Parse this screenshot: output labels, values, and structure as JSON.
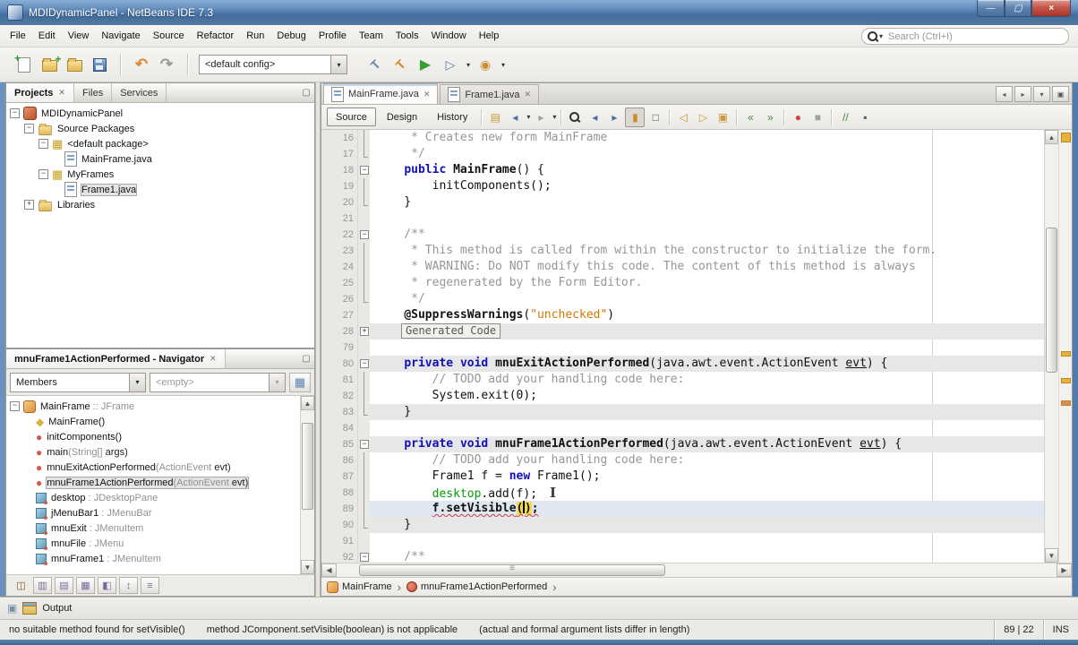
{
  "titlebar": {
    "title": "MDIDynamicPanel - NetBeans IDE 7.3"
  },
  "menubar": {
    "items": [
      "File",
      "Edit",
      "View",
      "Navigate",
      "Source",
      "Refactor",
      "Run",
      "Debug",
      "Profile",
      "Team",
      "Tools",
      "Window",
      "Help"
    ],
    "search_placeholder": "Search (Ctrl+I)"
  },
  "toolbar": {
    "config_value": "<default config>"
  },
  "icons": {
    "window-minimize": "—",
    "window-maximize": "▢",
    "window-close": "×",
    "undo": "↶",
    "redo": "↷",
    "build": "T",
    "clean-build": "T",
    "run": "▶",
    "debug": "▷",
    "profile": "◉",
    "combo-arrow": "▾",
    "dropdown-caret": "▾",
    "tab-scroll-left": "◂",
    "tab-scroll-right": "▸",
    "tab-list": "▾",
    "maximize-editor": "▣",
    "last-edit": "▤",
    "back": "◂",
    "forward": "▸",
    "find-prev": "◂",
    "find-next": "▸",
    "highlight": "▮",
    "rect-select": "□",
    "prev-bookmark": "◁",
    "next-bookmark": "▷",
    "toggle-bookmark": "▣",
    "shift-left": "«",
    "shift-right": "»",
    "record-macro": "●",
    "stop-macro": "■",
    "toggle-comment": "//",
    "inspect": "▪",
    "panel-minimize": "▢",
    "scroll-up": "▲",
    "scroll-down": "▼",
    "dock": "▣",
    "package": "▦",
    "show-inherited": "◫",
    "show-fields": "▥",
    "show-static": "▤",
    "show-public": "▦",
    "show-non-public": "◧",
    "sort-alpha": "↕",
    "sort-by-source": "≡",
    "nav-settings": "▦"
  },
  "projects_panel": {
    "tabs": [
      {
        "label": "Projects",
        "active": true,
        "closable": true
      },
      {
        "label": "Files"
      },
      {
        "label": "Services"
      }
    ],
    "tree": [
      {
        "label": "MDIDynamicPanel",
        "depth": 0,
        "icon": "project",
        "handle": "minus"
      },
      {
        "label": "Source Packages",
        "depth": 1,
        "icon": "folder",
        "handle": "minus"
      },
      {
        "label": "<default package>",
        "depth": 2,
        "icon": "package",
        "handle": "minus"
      },
      {
        "label": "MainFrame.java",
        "depth": 3,
        "icon": "form-file",
        "handle": "none"
      },
      {
        "label": "MyFrames",
        "depth": 2,
        "icon": "package",
        "handle": "minus"
      },
      {
        "label": "Frame1.java",
        "depth": 3,
        "icon": "file",
        "handle": "none",
        "selected": true
      },
      {
        "label": "Libraries",
        "depth": 1,
        "icon": "folder",
        "handle": "plus"
      }
    ]
  },
  "navigator": {
    "title": "mnuFrame1ActionPerformed - Navigator",
    "filter_members": "Members",
    "filter_scope": "<empty>",
    "filter_buttons": [
      "show-inherited",
      "show-fields",
      "show-static",
      "show-public",
      "show-non-public",
      "sort-alpha",
      "sort-by-source"
    ],
    "members": [
      {
        "name": "MainFrame",
        "sig": " :: JFrame",
        "icon": "class",
        "depth": 0,
        "handle": "minus"
      },
      {
        "name": "MainFrame()",
        "icon": "constructor",
        "depth": 1
      },
      {
        "name": "initComponents()",
        "icon": "method-private",
        "depth": 1
      },
      {
        "name": "main",
        "sig": "(String[] ",
        "sig2": "args)",
        "icon": "method-static",
        "depth": 1
      },
      {
        "name": "mnuExitActionPerformed",
        "sig": "(ActionEvent ",
        "sig2": "evt)",
        "icon": "method-private",
        "depth": 1
      },
      {
        "name": "mnuFrame1ActionPerformed",
        "sig": "(ActionEvent ",
        "sig2": "evt)",
        "icon": "method-private",
        "depth": 1,
        "selected": true
      },
      {
        "name": "desktop",
        "sig": " : JDesktopPane",
        "icon": "field",
        "depth": 1
      },
      {
        "name": "jMenuBar1",
        "sig": " : JMenuBar",
        "icon": "field",
        "depth": 1
      },
      {
        "name": "mnuExit",
        "sig": " : JMenuItem",
        "icon": "field",
        "depth": 1
      },
      {
        "name": "mnuFile",
        "sig": " : JMenu",
        "icon": "field",
        "depth": 1
      },
      {
        "name": "mnuFrame1",
        "sig": " : JMenuItem",
        "icon": "field",
        "depth": 1
      }
    ]
  },
  "editor": {
    "tabs": [
      {
        "label": "MainFrame.java",
        "active": true
      },
      {
        "label": "Frame1.java"
      }
    ],
    "view_buttons": [
      "Source",
      "Design",
      "History"
    ],
    "breadcrumb": [
      {
        "label": "MainFrame",
        "icon": "class"
      },
      {
        "label": "mnuFrame1ActionPerformed",
        "icon": "method"
      }
    ],
    "lines": [
      {
        "n": 16,
        "f": "mid",
        "t": [
          [
            "c",
            "     * Creates new form MainFrame"
          ]
        ]
      },
      {
        "n": 17,
        "f": "end",
        "t": [
          [
            "c",
            "     */"
          ]
        ]
      },
      {
        "n": 18,
        "f": "start",
        "t": [
          [
            "p",
            "    "
          ],
          [
            "k",
            "public"
          ],
          [
            "p",
            " "
          ],
          [
            "b",
            "MainFrame"
          ],
          [
            "p",
            "() {"
          ]
        ]
      },
      {
        "n": 19,
        "f": "mid",
        "t": [
          [
            "p",
            "        initComponents();"
          ]
        ]
      },
      {
        "n": 20,
        "f": "end",
        "t": [
          [
            "p",
            "    }"
          ]
        ]
      },
      {
        "n": 21,
        "f": "",
        "t": []
      },
      {
        "n": 22,
        "f": "start",
        "t": [
          [
            "c",
            "    /**"
          ]
        ]
      },
      {
        "n": 23,
        "f": "mid",
        "t": [
          [
            "c",
            "     * This method is called from within the constructor to initialize the form."
          ]
        ]
      },
      {
        "n": 24,
        "f": "mid",
        "t": [
          [
            "c",
            "     * WARNING: Do NOT modify this code. The content of this method is always"
          ]
        ]
      },
      {
        "n": 25,
        "f": "mid",
        "t": [
          [
            "c",
            "     * regenerated by the Form Editor."
          ]
        ]
      },
      {
        "n": 26,
        "f": "end",
        "t": [
          [
            "c",
            "     */"
          ]
        ]
      },
      {
        "n": 27,
        "f": "",
        "t": [
          [
            "p",
            "    "
          ],
          [
            "b",
            "@SuppressWarnings"
          ],
          [
            "p",
            "("
          ],
          [
            "s",
            "\"unchecked\""
          ],
          [
            "p",
            ")"
          ]
        ]
      },
      {
        "n": 28,
        "f": "plus",
        "bg": "guarded",
        "box": "Generated Code",
        "t": []
      },
      {
        "n": 79,
        "f": "",
        "t": []
      },
      {
        "n": 80,
        "f": "start",
        "bg": "guarded",
        "t": [
          [
            "p",
            "    "
          ],
          [
            "k",
            "private"
          ],
          [
            "p",
            " "
          ],
          [
            "k",
            "void"
          ],
          [
            "p",
            " "
          ],
          [
            "b",
            "mnuExitActionPerformed"
          ],
          [
            "p",
            "(java.awt.event.ActionEvent "
          ],
          [
            "u",
            "evt"
          ],
          [
            "p",
            ") {"
          ]
        ]
      },
      {
        "n": 81,
        "f": "mid",
        "t": [
          [
            "c",
            "        // TODO add your handling code here:"
          ]
        ]
      },
      {
        "n": 82,
        "f": "mid",
        "t": [
          [
            "p",
            "        System.exit(0);"
          ]
        ]
      },
      {
        "n": 83,
        "f": "end",
        "bg": "guarded",
        "t": [
          [
            "p",
            "    }"
          ]
        ]
      },
      {
        "n": 84,
        "f": "",
        "t": []
      },
      {
        "n": 85,
        "f": "start",
        "bg": "guarded",
        "t": [
          [
            "p",
            "    "
          ],
          [
            "k",
            "private"
          ],
          [
            "p",
            " "
          ],
          [
            "k",
            "void"
          ],
          [
            "p",
            " "
          ],
          [
            "b",
            "mnuFrame1ActionPerformed"
          ],
          [
            "p",
            "(java.awt.event.ActionEvent "
          ],
          [
            "u",
            "evt"
          ],
          [
            "p",
            ") {"
          ]
        ]
      },
      {
        "n": 86,
        "f": "mid",
        "t": [
          [
            "c",
            "        // TODO add your handling code here:"
          ]
        ]
      },
      {
        "n": 87,
        "f": "mid",
        "t": [
          [
            "p",
            "        Frame1 f = "
          ],
          [
            "k",
            "new"
          ],
          [
            "p",
            " Frame1();"
          ]
        ]
      },
      {
        "n": 88,
        "f": "mid",
        "t": [
          [
            "p",
            "        "
          ],
          [
            "g",
            "desktop"
          ],
          [
            "p",
            ".add(f);"
          ],
          [
            "mouse",
            ""
          ]
        ]
      },
      {
        "n": 89,
        "f": "mid",
        "bg": "current",
        "t": [
          [
            "p",
            "        "
          ],
          [
            "e",
            "f.setVisible"
          ],
          [
            "y",
            "("
          ],
          [
            "caret",
            ""
          ],
          [
            "y",
            ")"
          ],
          [
            "e",
            ";"
          ]
        ]
      },
      {
        "n": 90,
        "f": "end",
        "bg": "guarded",
        "t": [
          [
            "p",
            "    }"
          ]
        ]
      },
      {
        "n": 91,
        "f": "",
        "t": []
      },
      {
        "n": 92,
        "f": "start",
        "t": [
          [
            "c",
            "    /**"
          ]
        ]
      }
    ]
  },
  "output_bar": {
    "label": "Output"
  },
  "statusbar": {
    "messages": [
      "no suitable method found for setVisible()",
      "method JComponent.setVisible(boolean) is not applicable",
      "(actual and formal argument lists differ in length)"
    ],
    "caret_position": "89 | 22",
    "insert_mode": "INS"
  }
}
